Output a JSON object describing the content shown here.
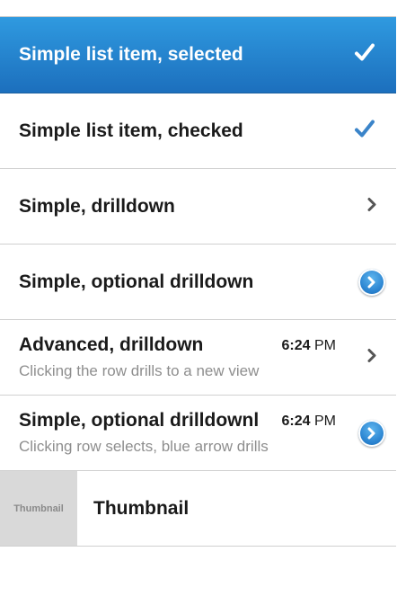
{
  "list": {
    "items": [
      {
        "title": "Simple list item, selected",
        "accessory": "white-checkmark-icon"
      },
      {
        "title": "Simple list item, checked",
        "accessory": "blue-checkmark-icon"
      },
      {
        "title": "Simple, drilldown",
        "accessory": "chevron-right-icon"
      },
      {
        "title": "Simple, optional drilldown",
        "accessory": "blue-arrow-button-icon"
      },
      {
        "title": "Advanced, drilldown",
        "time": "6:24",
        "ampm": "PM",
        "subtitle": "Clicking the row drills to a new view",
        "accessory": "chevron-right-icon"
      },
      {
        "title": "Simple, optional drilldownl",
        "time": "6:24",
        "ampm": "PM",
        "subtitle": "Clicking row selects, blue arrow drills",
        "accessory": "blue-arrow-button-icon"
      },
      {
        "title": "Thumbnail",
        "thumbnail_label": "Thumbnail"
      }
    ]
  },
  "colors": {
    "selected_gradient_top": "#2f9ae0",
    "selected_gradient_bottom": "#1c6fbd",
    "check_blue": "#3a84c9",
    "subtitle_gray": "#8e8e8e",
    "thumbnail_bg": "#d9d9d9"
  }
}
